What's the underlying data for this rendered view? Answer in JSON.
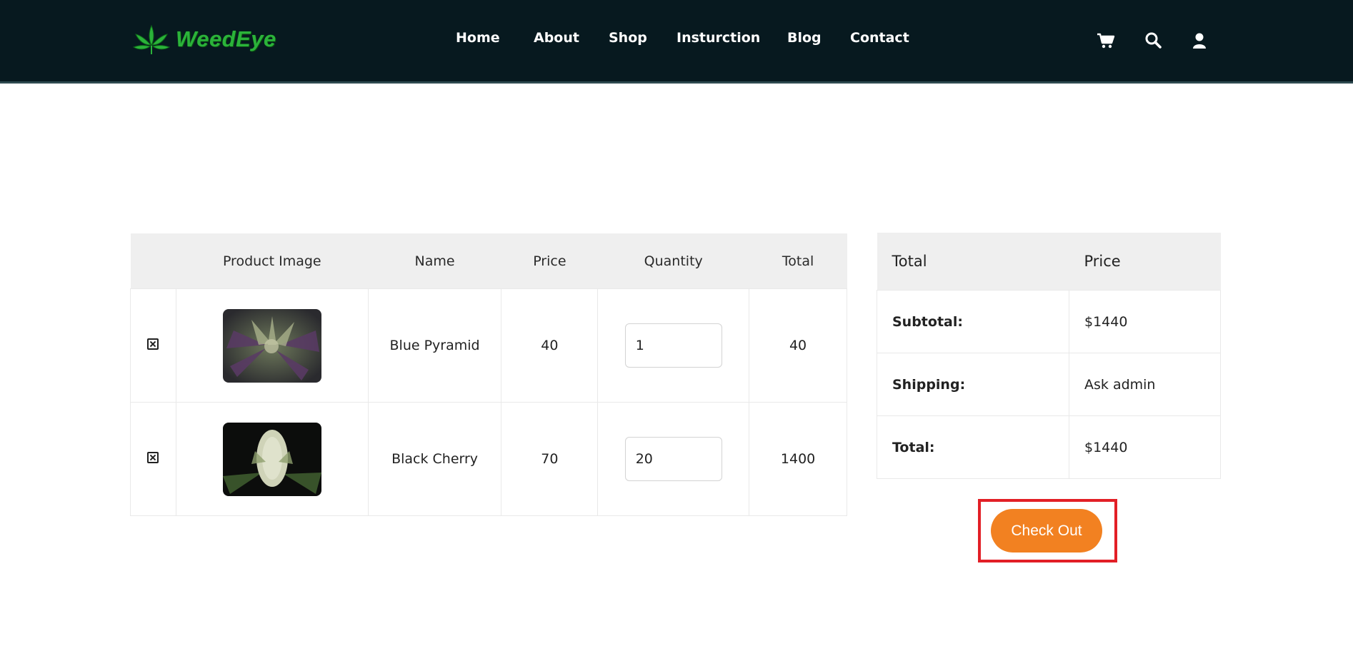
{
  "brand": {
    "name": "WeedEye",
    "logo_icon": "cannabis-leaf-icon",
    "color": "#2bb33a"
  },
  "nav": [
    "Home",
    "About",
    "Shop",
    "Insturction",
    "Blog",
    "Contact"
  ],
  "header_icons": [
    "cart-icon",
    "search-icon",
    "user-icon"
  ],
  "cart": {
    "columns": [
      "",
      "Product Image",
      "Name",
      "Price",
      "Quantity",
      "Total"
    ],
    "rows": [
      {
        "name": "Blue Pyramid",
        "price": "40",
        "quantity": "1",
        "total": "40",
        "image": "blue-pyramid-plant-image"
      },
      {
        "name": "Black Cherry",
        "price": "70",
        "quantity": "20",
        "total": "1400",
        "image": "black-cherry-bud-image"
      }
    ]
  },
  "totals": {
    "headers": [
      "Total",
      "Price"
    ],
    "rows": [
      {
        "label": "Subtotal:",
        "value": "$1440"
      },
      {
        "label": "Shipping:",
        "value": "Ask admin"
      },
      {
        "label": "Total:",
        "value": "$1440"
      }
    ]
  },
  "checkout_label": "Check Out",
  "colors": {
    "header_bg": "#07191f",
    "accent": "#f28121",
    "highlight_border": "#e21f26"
  }
}
